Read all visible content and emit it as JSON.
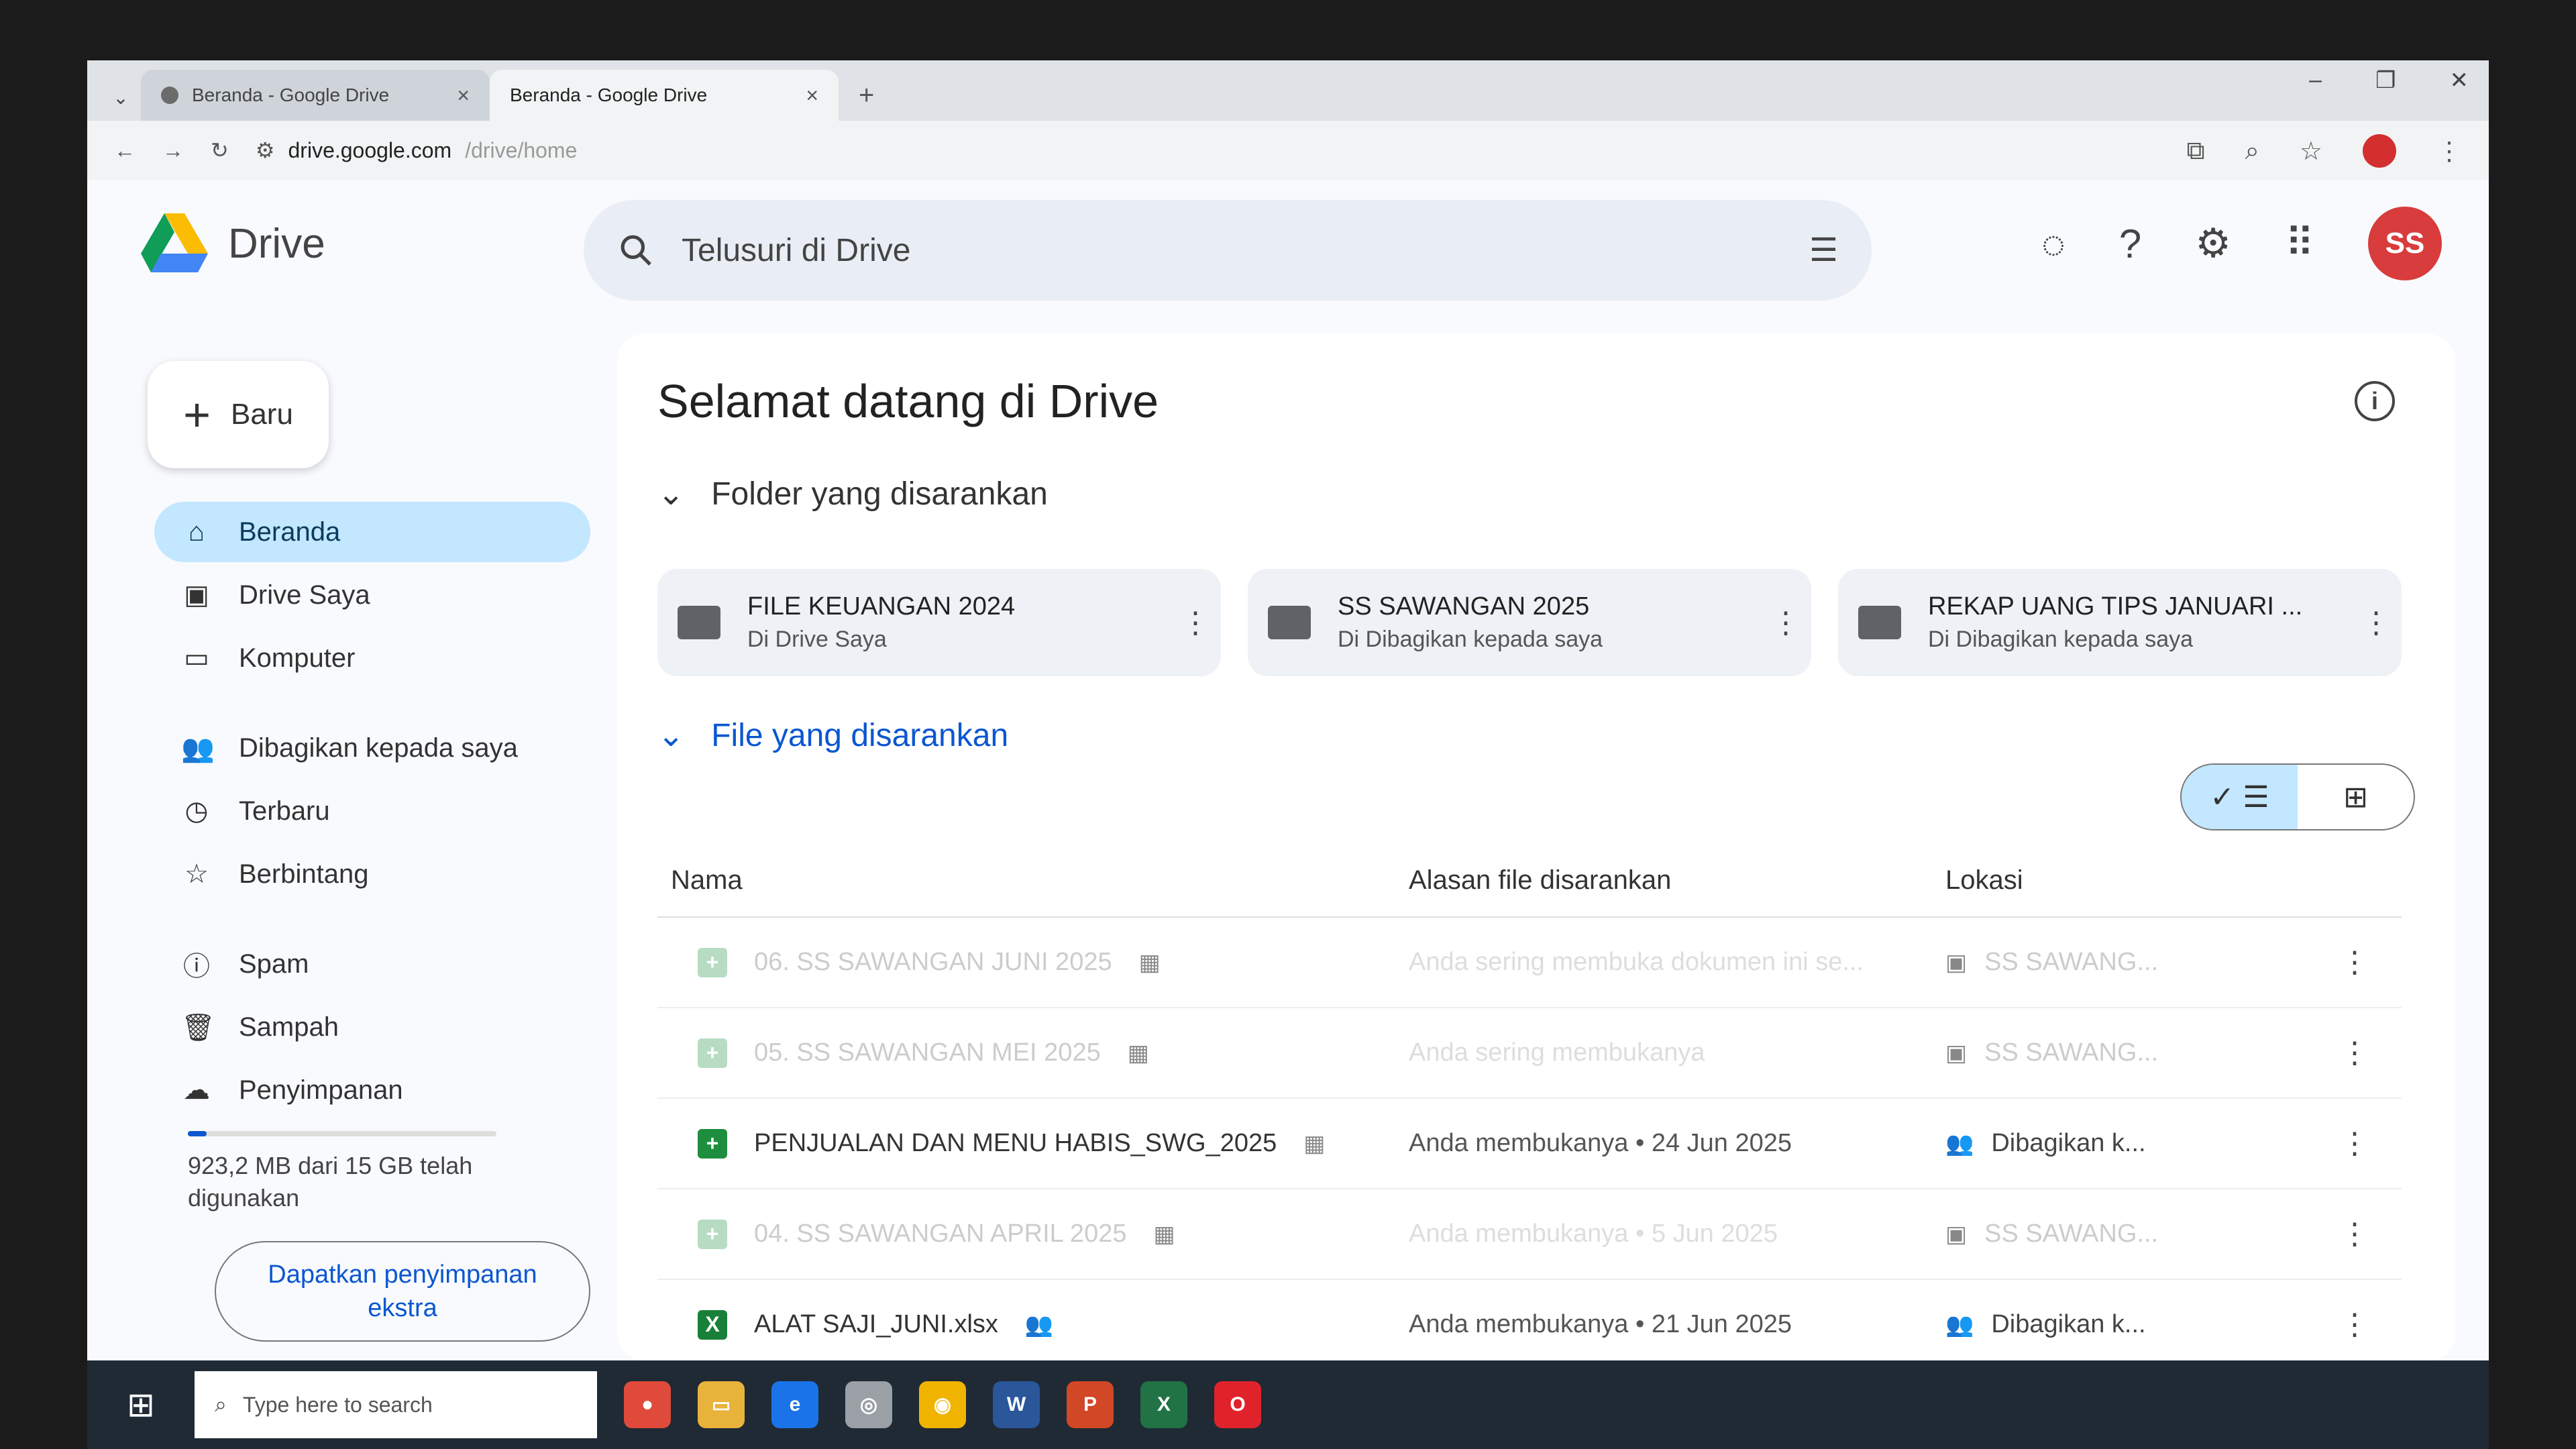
{
  "browser": {
    "tabs": [
      {
        "title": "Beranda - Google Drive",
        "active": false
      },
      {
        "title": "Beranda - Google Drive",
        "active": true
      }
    ],
    "address_host": "drive.google.com",
    "address_path": "/drive/home"
  },
  "app": {
    "name": "Drive",
    "search_placeholder": "Telusuri di Drive",
    "avatar_text": "SS",
    "new_label": "Baru"
  },
  "nav": {
    "items": [
      {
        "label": "Beranda",
        "icon": "home-icon"
      },
      {
        "label": "Drive Saya",
        "icon": "my-drive-icon"
      },
      {
        "label": "Komputer",
        "icon": "computer-icon"
      },
      {
        "label": "Dibagikan kepada saya",
        "icon": "shared-icon"
      },
      {
        "label": "Terbaru",
        "icon": "clock-icon"
      },
      {
        "label": "Berbintang",
        "icon": "star-icon"
      },
      {
        "label": "Spam",
        "icon": "spam-icon"
      },
      {
        "label": "Sampah",
        "icon": "trash-icon"
      },
      {
        "label": "Penyimpanan",
        "icon": "cloud-icon"
      }
    ],
    "storage_text": "923,2 MB dari 15 GB telah digunakan",
    "storage_used_fraction": 0.06,
    "get_storage_label": "Dapatkan penyimpanan ekstra"
  },
  "main": {
    "welcome": "Selamat datang di Drive",
    "folders_heading": "Folder yang disarankan",
    "folders": [
      {
        "name": "FILE KEUANGAN 2024",
        "location": "Di Drive Saya"
      },
      {
        "name": "SS SAWANGAN 2025",
        "location": "Di Dibagikan kepada saya"
      },
      {
        "name": "REKAP UANG TIPS JANUARI ...",
        "location": "Di Dibagikan kepada saya"
      }
    ],
    "files_heading": "File yang disarankan",
    "columns": {
      "name": "Nama",
      "reason": "Alasan file disarankan",
      "location": "Lokasi"
    },
    "files": [
      {
        "name": "06. SS SAWANGAN JUNI 2025",
        "reason": "Anda sering membuka dokumen ini se...",
        "location": "SS SAWANG...",
        "faded": true,
        "type": "sheet"
      },
      {
        "name": "05. SS SAWANGAN MEI 2025",
        "reason": "Anda sering membukanya",
        "location": "SS SAWANG...",
        "faded": true,
        "type": "sheet"
      },
      {
        "name": "PENJUALAN DAN MENU HABIS_SWG_2025",
        "reason": "Anda membukanya • 24 Jun 2025",
        "location": "Dibagikan k...",
        "faded": false,
        "type": "sheet"
      },
      {
        "name": "04. SS SAWANGAN APRIL 2025",
        "reason": "Anda membukanya • 5 Jun 2025",
        "location": "SS SAWANG...",
        "faded": true,
        "type": "sheet"
      },
      {
        "name": "ALAT SAJI_JUNI.xlsx",
        "reason": "Anda membukanya • 21 Jun 2025",
        "location": "Dibagikan k...",
        "faded": false,
        "type": "xlsx"
      }
    ]
  },
  "taskbar": {
    "search_placeholder": "Type here to search"
  }
}
